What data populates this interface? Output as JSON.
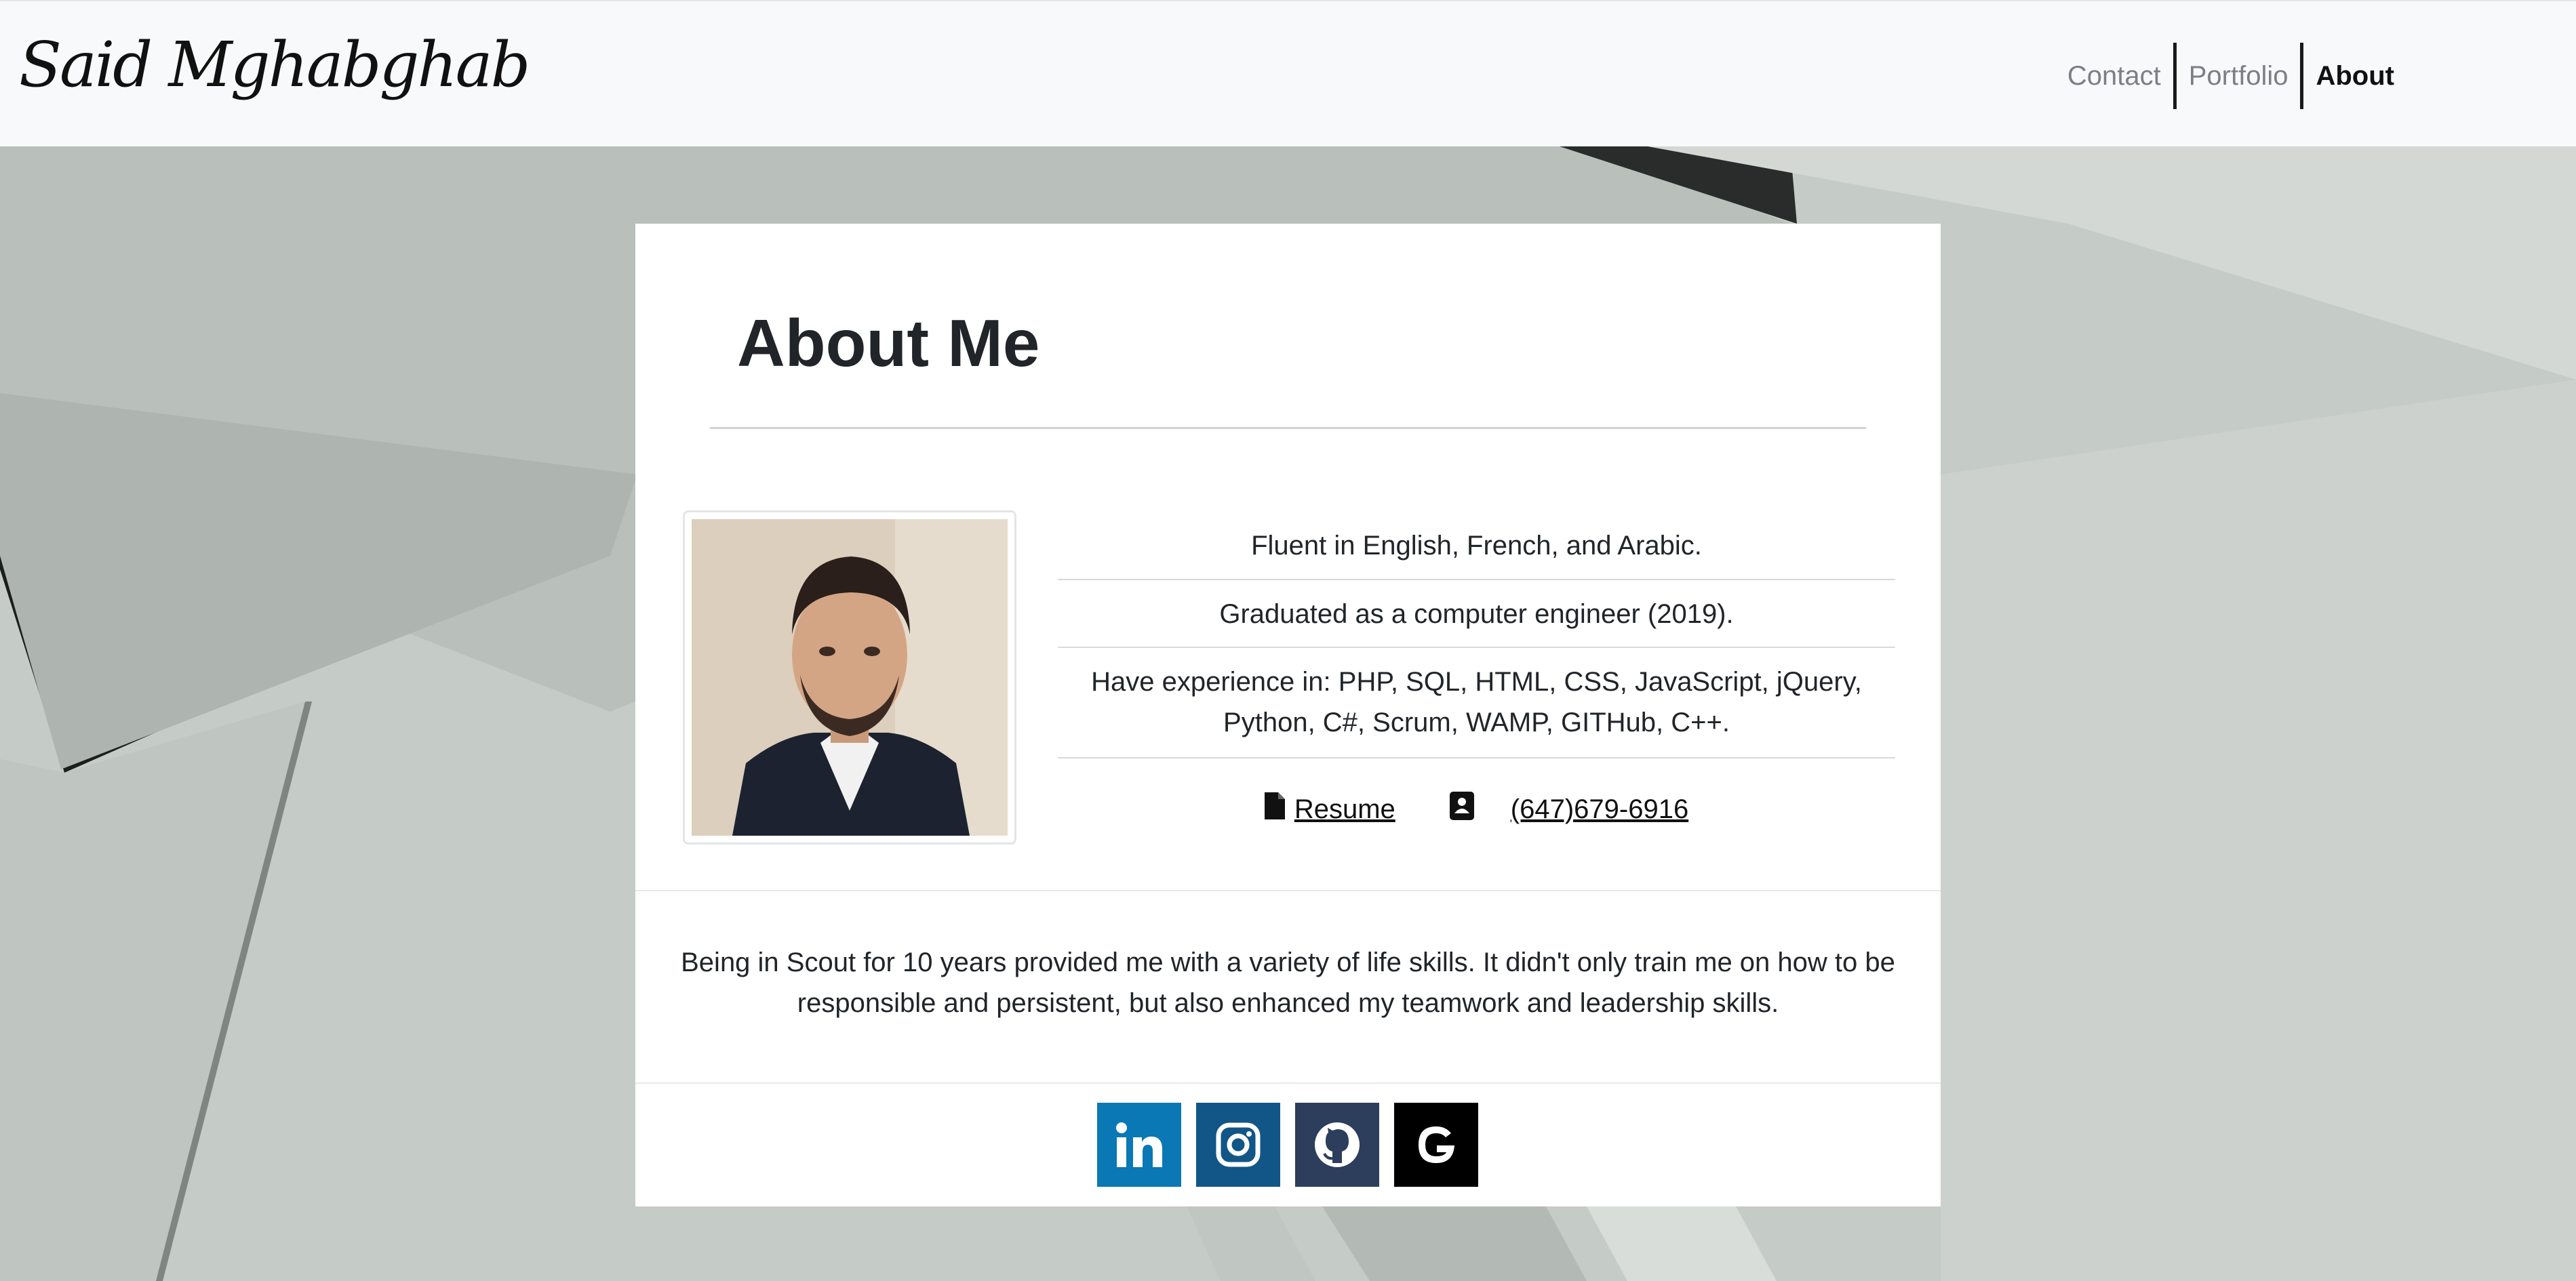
{
  "brand": {
    "name": "Said Mghabghab"
  },
  "nav": {
    "items": [
      {
        "label": "Contact",
        "active": false
      },
      {
        "label": "Portfolio",
        "active": false
      },
      {
        "label": "About",
        "active": true
      }
    ]
  },
  "about": {
    "title": "About Me",
    "facts": [
      "Fluent in English, French, and Arabic.",
      "Graduated as a computer engineer (2019).",
      "Have experience in: PHP, SQL, HTML, CSS, JavaScript, jQuery, Python, C#, Scrum, WAMP, GITHub, C++."
    ],
    "resume_label": "Resume",
    "phone": "(647)679-6916",
    "bio": "Being in Scout for 10 years provided me with a variety of life skills. It didn't only train me on how to be responsible and persistent, but also enhanced my teamwork and leadership skills."
  },
  "socials": [
    {
      "name": "linkedin-icon",
      "color": "#0a78b4"
    },
    {
      "name": "instagram-icon",
      "color": "#125688"
    },
    {
      "name": "github-icon",
      "color": "#2c3e5c"
    },
    {
      "name": "google-icon",
      "color": "#000000"
    }
  ],
  "icons": {
    "resume": "file-icon",
    "phone": "contact-card-icon"
  }
}
